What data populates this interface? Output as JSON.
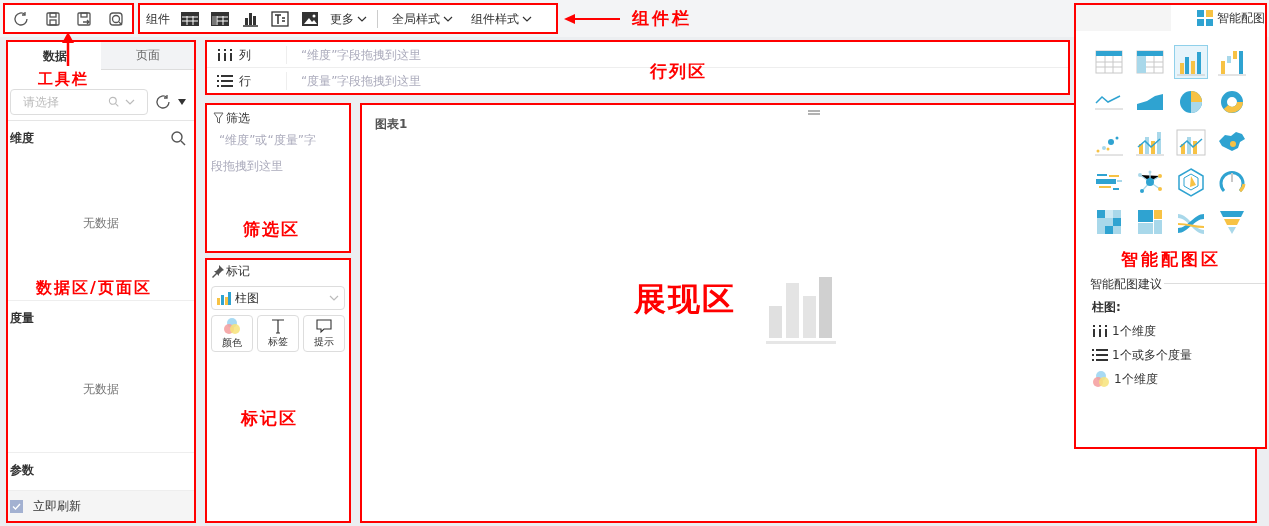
{
  "toolbar": {
    "annotation": "工具栏",
    "buttons": [
      {
        "kind": "refresh"
      },
      {
        "kind": "save"
      },
      {
        "kind": "save-as"
      },
      {
        "kind": "preview"
      }
    ]
  },
  "component_bar": {
    "annotation": "组件栏",
    "label": "组件",
    "components": [
      {
        "kind": "table"
      },
      {
        "kind": "crosstable"
      },
      {
        "kind": "bar"
      },
      {
        "kind": "text"
      },
      {
        "kind": "image"
      }
    ],
    "more": "更多",
    "styles": [
      "全局样式",
      "组件样式"
    ]
  },
  "data_panel": {
    "annotation": "数据区/页面区",
    "tabs": [
      {
        "label": "数据",
        "selected": true
      },
      {
        "label": "页面",
        "selected": false
      }
    ],
    "select": {
      "placeholder": "请选择"
    },
    "sections": [
      {
        "title": "维度",
        "search": true,
        "empty": "无数据"
      },
      {
        "title": "度量",
        "search": false,
        "empty": "无数据"
      },
      {
        "title": "参数",
        "search": false
      }
    ],
    "auto_refresh": {
      "label": "立即刷新",
      "checked": true
    }
  },
  "row_column": {
    "annotation": "行列区",
    "shelves": [
      {
        "kind": "column",
        "label": "列",
        "hint": "“维度”字段拖拽到这里"
      },
      {
        "kind": "row",
        "label": "行",
        "hint": "“度量”字段拖拽到这里"
      }
    ]
  },
  "filter": {
    "annotation": "筛选区",
    "title": "筛选",
    "hint_lines": [
      "“维度”或“度量”字",
      "段拖拽到这里"
    ]
  },
  "marks": {
    "annotation": "标记区",
    "title": "标记",
    "chart_select": "柱图",
    "buttons": [
      {
        "kind": "color",
        "label": "颜色"
      },
      {
        "kind": "text",
        "label": "标签"
      },
      {
        "kind": "tooltip",
        "label": "提示"
      }
    ]
  },
  "canvas": {
    "annotation": "展现区",
    "title": "图表1"
  },
  "smart_chart": {
    "annotation": "智能配图区",
    "tab": "智能配图",
    "chart_types": [
      {
        "kind": "table",
        "selected": false
      },
      {
        "kind": "crosstable",
        "selected": false
      },
      {
        "kind": "bar",
        "selected": true
      },
      {
        "kind": "waterfall",
        "selected": false
      },
      {
        "kind": "line",
        "selected": false
      },
      {
        "kind": "area",
        "selected": false
      },
      {
        "kind": "pie",
        "selected": false
      },
      {
        "kind": "donut",
        "selected": false
      },
      {
        "kind": "scatter",
        "selected": false
      },
      {
        "kind": "bar-line",
        "selected": false
      },
      {
        "kind": "bar-line-framed",
        "selected": false
      },
      {
        "kind": "map",
        "selected": false
      },
      {
        "kind": "wordcloud",
        "selected": false
      },
      {
        "kind": "network",
        "selected": false
      },
      {
        "kind": "radar",
        "selected": false
      },
      {
        "kind": "gauge",
        "selected": false
      },
      {
        "kind": "heatmap",
        "selected": false
      },
      {
        "kind": "treemap",
        "selected": false
      },
      {
        "kind": "flow",
        "selected": false
      },
      {
        "kind": "funnel",
        "selected": false
      }
    ],
    "suggestion_title": "智能配图建议",
    "suggestion_chart": "柱图:",
    "requirements": [
      {
        "kind": "dimension",
        "text": "1个维度"
      },
      {
        "kind": "measure",
        "text": "1个或多个度量"
      },
      {
        "kind": "color",
        "text": "1个维度"
      }
    ]
  }
}
